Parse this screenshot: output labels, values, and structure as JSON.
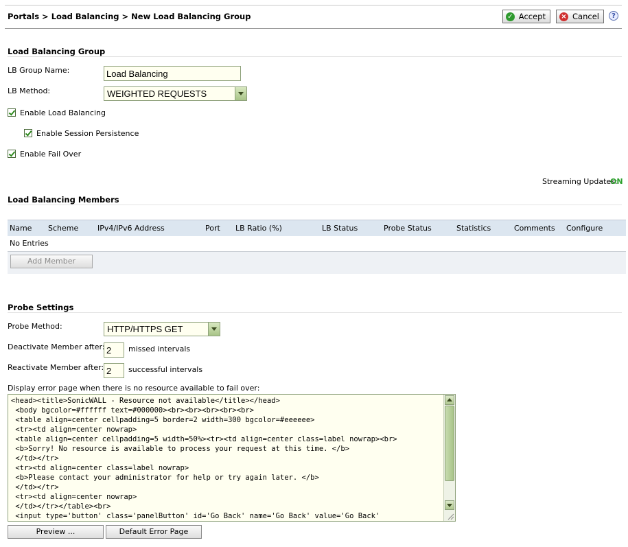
{
  "breadcrumb": [
    "Portals",
    ">",
    "Load Balancing",
    ">",
    "New Load Balancing Group"
  ],
  "header": {
    "accept_label": "Accept",
    "cancel_label": "Cancel",
    "help_glyph": "?"
  },
  "group": {
    "heading": "Load Balancing Group",
    "name_label": "LB Group Name:",
    "name_value": "Load Balancing",
    "method_label": "LB Method:",
    "method_value": "WEIGHTED REQUESTS",
    "enable_lb_label": "Enable Load Balancing",
    "enable_lb_checked": true,
    "session_persistence_label": "Enable Session Persistence",
    "session_persistence_checked": true,
    "failover_label": "Enable Fail Over",
    "failover_checked": true
  },
  "streaming": {
    "label": "Streaming Updates:",
    "value": "ON",
    "value_color": "#2ca02c"
  },
  "members": {
    "heading": "Load Balancing Members",
    "columns": [
      "Name",
      "Scheme",
      "IPv4/IPv6 Address",
      "Port",
      "LB Ratio (%)",
      "LB Status",
      "Probe Status",
      "Statistics",
      "Comments",
      "Configure"
    ],
    "empty_text": "No Entries",
    "add_label": "Add Member"
  },
  "probe": {
    "heading": "Probe Settings",
    "method_label": "Probe Method:",
    "method_value": "HTTP/HTTPS GET",
    "deactivate_label": "Deactivate Member after:",
    "deactivate_value": "2",
    "deactivate_suffix": "missed intervals",
    "reactivate_label": "Reactivate Member after:",
    "reactivate_value": "2",
    "reactivate_suffix": "successful intervals",
    "error_label": "Display error page when there is no resource available to fail over:",
    "error_html": "<head><title>SonicWALL - Resource not available</title></head>\n <body bgcolor=#ffffff text=#000000><br><br><br><br><br>\n <table align=center cellpadding=5 border=2 width=300 bgcolor=#eeeeee>\n <tr><td align=center nowrap>\n <table align=center cellpadding=5 width=50%><tr><td align=center class=label nowrap><br>\n <b>Sorry! No resource is available to process your request at this time. </b>\n </td></tr>\n <tr><td align=center class=label nowrap>\n <b>Please contact your administrator for help or try again later. </b>\n </td></tr>\n <tr><td align=center nowrap>\n </td></tr></table><br>\n <input type='button' class='panelButton' id='Go Back' name='Go Back' value='Go Back'",
    "preview_label": "Preview ...",
    "default_label": "Default Error Page"
  }
}
